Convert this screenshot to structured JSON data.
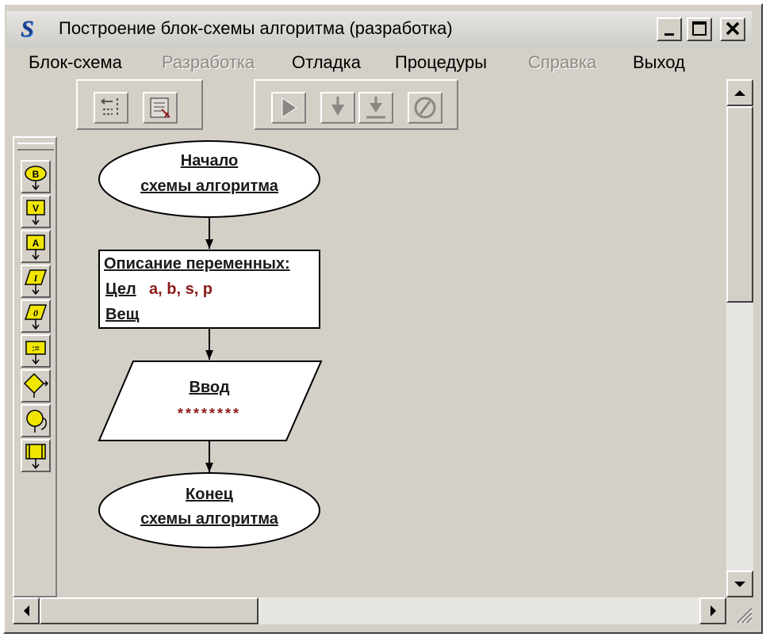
{
  "window": {
    "title": "Построение блок-схемы алгоритма (разработка)",
    "app_icon": "S",
    "controls": [
      "minimize-icon",
      "maximize-icon",
      "close-icon"
    ]
  },
  "menu": {
    "items": [
      {
        "label": "Блок-схема",
        "enabled": true
      },
      {
        "label": "Разработка",
        "enabled": false
      },
      {
        "label": "Отладка",
        "enabled": true
      },
      {
        "label": "Процедуры",
        "enabled": true
      },
      {
        "label": "Справка",
        "enabled": false
      },
      {
        "label": "Выход",
        "enabled": true
      }
    ]
  },
  "toolbar": {
    "groups": [
      {
        "buttons": [
          "align-icon",
          "edit-scheme-icon"
        ]
      },
      {
        "buttons": [
          "run-icon",
          "step-icon",
          "step-over-icon",
          "stop-icon"
        ]
      }
    ]
  },
  "palette": {
    "blocks": [
      {
        "icon": "begin-block-icon",
        "glyph": "B"
      },
      {
        "icon": "variables-block-icon",
        "glyph": "V"
      },
      {
        "icon": "array-block-icon",
        "glyph": "A"
      },
      {
        "icon": "input-block-icon",
        "glyph": "I"
      },
      {
        "icon": "output-block-icon",
        "glyph": "0"
      },
      {
        "icon": "assign-block-icon",
        "glyph": ":="
      },
      {
        "icon": "condition-block-icon",
        "glyph": ""
      },
      {
        "icon": "loop-block-icon",
        "glyph": ""
      },
      {
        "icon": "procedure-block-icon",
        "glyph": ""
      }
    ]
  },
  "flowchart": {
    "start": {
      "line1": "Начало",
      "line2": "схемы алгоритма"
    },
    "vars": {
      "heading": "Описание переменных:",
      "int_label": "Цел",
      "int_values": "a, b, s, p",
      "real_label": "Вещ"
    },
    "input": {
      "label": "Ввод",
      "placeholder": "********"
    },
    "end": {
      "line1": "Конец",
      "line2": "схемы алгоритма"
    }
  },
  "colors": {
    "title_icon": "#1a3f8c",
    "palette_yellow": "#f0e600",
    "value_text": "#8b1a1a",
    "canvas": "#d4d0c8"
  }
}
